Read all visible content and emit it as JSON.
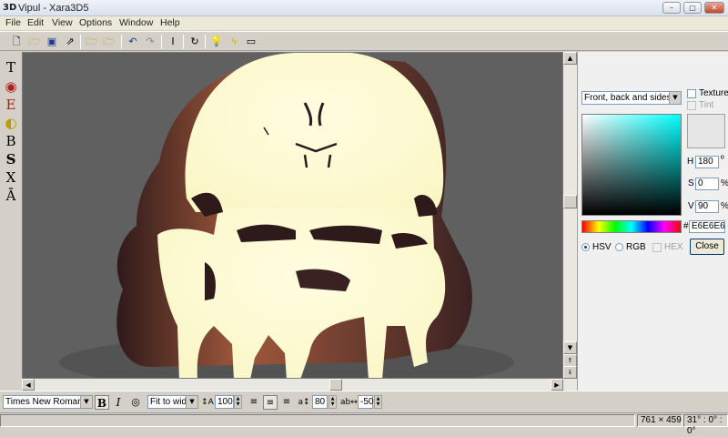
{
  "window": {
    "icon_label": "3D",
    "title": "Vipul - Xara3D5",
    "minimize": "–",
    "maximize": "▢",
    "close": "✕"
  },
  "menu": [
    "File",
    "Edit",
    "View",
    "Options",
    "Window",
    "Help"
  ],
  "toolbar": {
    "icons": [
      "new-icon",
      "open-icon",
      "save-icon",
      "export-icon",
      "save-as-icon",
      "open-design-icon",
      "save-design-icon",
      "undo-icon",
      "redo-icon",
      "text-cursor-icon",
      "rotate-icon",
      "light-bulb-icon",
      "animation-icon",
      "frame-icon"
    ]
  },
  "left_tools": [
    "text-tool",
    "color-tool",
    "extrusion-tool",
    "bevel-tool",
    "bold-tool",
    "shadow-tool",
    "x-tool",
    "texture-tool"
  ],
  "left_tool_glyphs": [
    "T",
    "◉",
    "E",
    "◐",
    "B",
    "S",
    "X",
    "Ā"
  ],
  "colors": {
    "text_face": "#fdfad0",
    "extrusion": "#4a2a2a",
    "canvas_background": "#606060",
    "current_color": "#E6E6E6"
  },
  "right_panel": {
    "apply_to": "Front, back and sides",
    "texture_label": "Texture",
    "tint_label": "Tint",
    "h_label": "H",
    "h_value": "180",
    "h_unit": "º",
    "s_label": "S",
    "s_value": "0",
    "s_unit": "%",
    "v_label": "V",
    "v_value": "90",
    "v_unit": "%",
    "hex_prefix": "#",
    "hex_value": "E6E6E6",
    "mode_hsv": "HSV",
    "mode_rgb": "RGB",
    "mode_hex": "HEX",
    "close_label": "Close"
  },
  "text_bar": {
    "font": "Times New Roman",
    "bold": "B",
    "italic": "I",
    "fit_mode": "Fit to width",
    "size_value": "100",
    "line_spacing_value": "80",
    "letter_spacing_value": "-50"
  },
  "status": {
    "dimensions": "761 × 459",
    "rotation": "31° : 0° : 0°"
  }
}
